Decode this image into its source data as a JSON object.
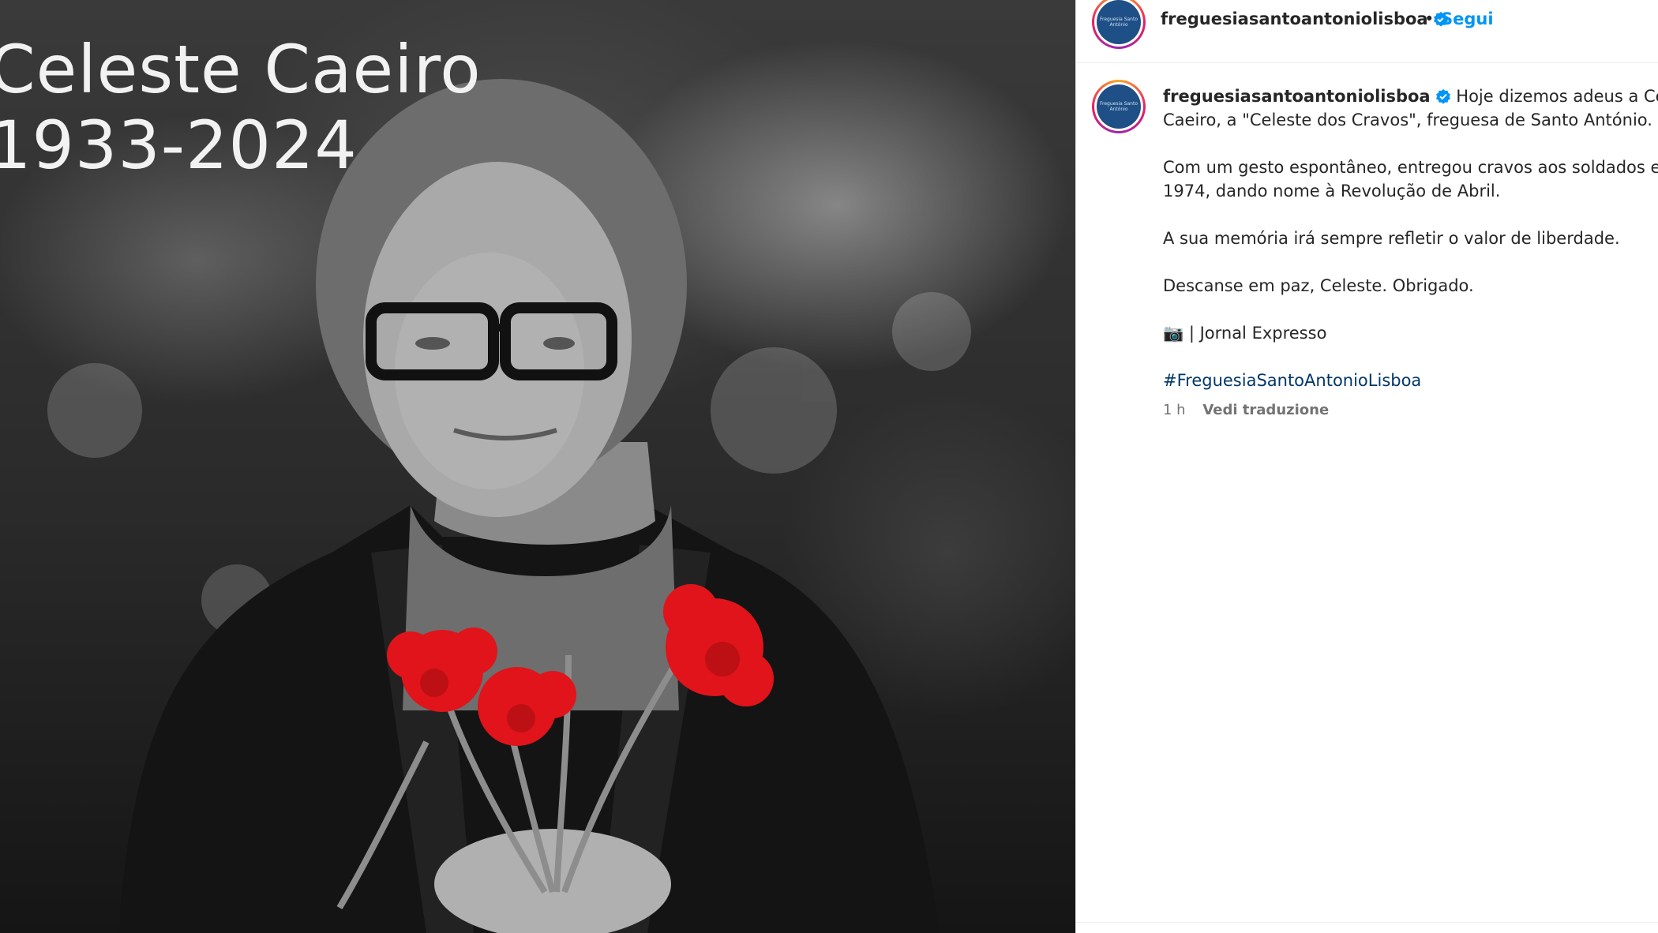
{
  "post_image": {
    "title_line1": "Celeste Caeiro",
    "title_line2": "1933-2024"
  },
  "header": {
    "username": "freguesiasantoantoniolisboa",
    "separator": "•",
    "follow_label": "Segui"
  },
  "caption": {
    "username": "freguesiasantoantoniolisboa",
    "line1": "Hoje dizemos adeus a Celeste",
    "line2": "Caeiro, a \"Celeste dos Cravos\", freguesa de Santo António.",
    "line3": "Com um gesto espontâneo, entregou cravos aos soldados em",
    "line4": "1974, dando nome à Revolução de Abril.",
    "line5": "A sua memória irá sempre refletir o valor de liberdade.",
    "line6": "Descanse em paz, Celeste. Obrigado.",
    "line7": "📷 | Jornal Expresso",
    "hashtag": "#FreguesiaSantoAntonioLisboa",
    "time": "1 h",
    "translate_label": "Vedi traduzione"
  },
  "avatar_text": "Freguesia Santo António",
  "colors": {
    "link": "#0095f6",
    "hashtag": "#00376b",
    "verified": "#0095f6",
    "carnation": "#e0141a"
  },
  "icons": [
    "verified-badge-icon",
    "camera-icon"
  ]
}
